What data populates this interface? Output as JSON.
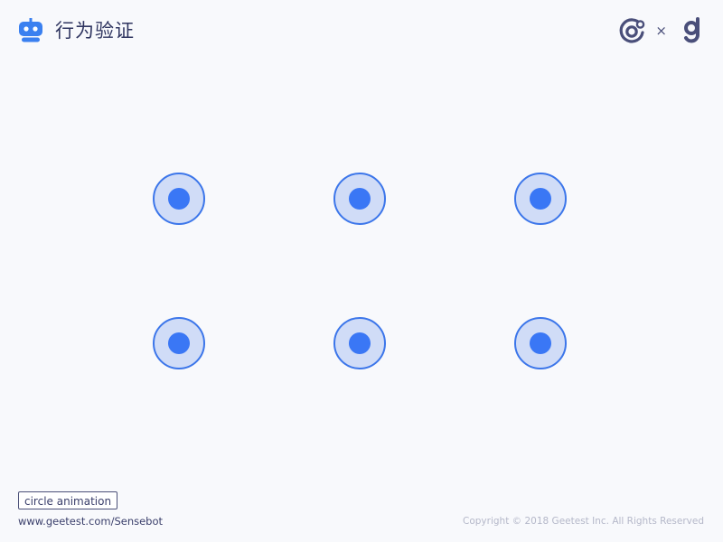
{
  "header": {
    "title": "行为验证",
    "brand_icon": "robot-icon",
    "partner_separator": "×",
    "partner_logos": [
      "sensebot-logo-icon",
      "geetest-logo-icon"
    ]
  },
  "grid": {
    "rows": 2,
    "cols": 3,
    "dot_icon": "target-dot-icon",
    "ring_color": "#3c76ea",
    "fill_color": "#d0dcf7",
    "core_color": "#3a77f5"
  },
  "footer": {
    "animation_badge": "circle animation",
    "link": "www.geetest.com/Sensebot",
    "copyright": "Copyright © 2018 Geetest Inc. All Rights Reserved"
  },
  "colors": {
    "background": "#f8f9fc",
    "brand_blue": "#3a80f0",
    "text_dark": "#2f3560",
    "text_muted": "#b5b8c9"
  }
}
